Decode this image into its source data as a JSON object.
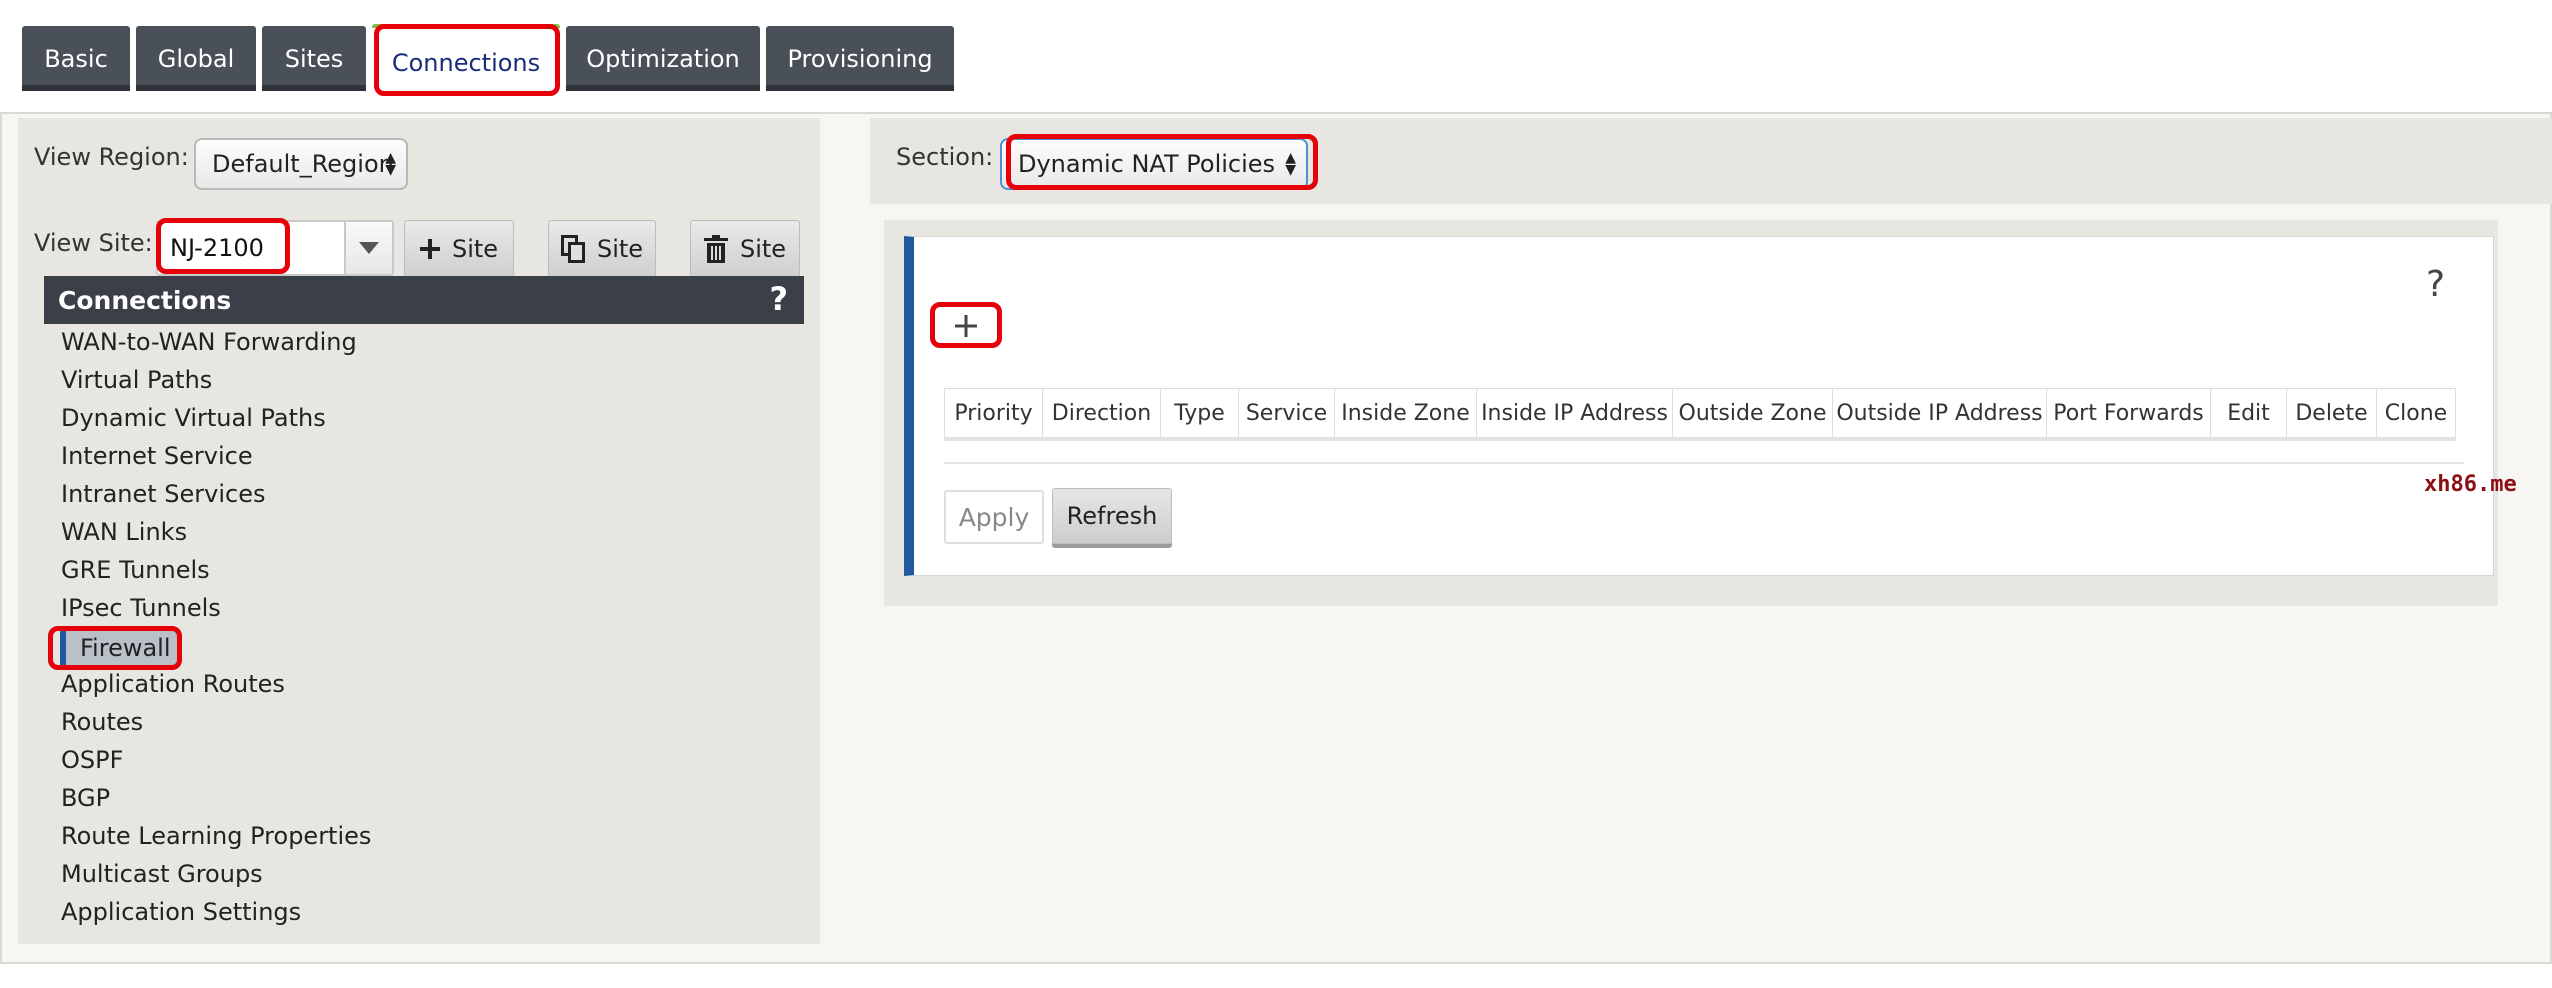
{
  "tabs": [
    {
      "label": "Basic",
      "active": false
    },
    {
      "label": "Global",
      "active": false
    },
    {
      "label": "Sites",
      "active": false
    },
    {
      "label": "Connections",
      "active": true
    },
    {
      "label": "Optimization",
      "active": false
    },
    {
      "label": "Provisioning",
      "active": false
    }
  ],
  "view_region": {
    "label": "View Region:",
    "value": "Default_Region"
  },
  "view_site": {
    "label": "View Site:",
    "value": "NJ-2100",
    "add_button": "Site",
    "copy_button": "Site",
    "delete_button": "Site"
  },
  "menu": {
    "title": "Connections",
    "help": "?",
    "items": [
      "WAN-to-WAN Forwarding",
      "Virtual Paths",
      "Dynamic Virtual Paths",
      "Internet Service",
      "Intranet Services",
      "WAN Links",
      "GRE Tunnels",
      "IPsec Tunnels",
      "Firewall",
      "Application Routes",
      "Routes",
      "OSPF",
      "BGP",
      "Route Learning Properties",
      "Multicast Groups",
      "Application Settings"
    ],
    "selected": "Firewall"
  },
  "section": {
    "label": "Section:",
    "value": "Dynamic NAT Policies"
  },
  "card": {
    "help": "?",
    "add_symbol": "+",
    "columns": [
      "Priority",
      "Direction",
      "Type",
      "Service",
      "Inside Zone",
      "Inside IP Address",
      "Outside Zone",
      "Outside IP Address",
      "Port Forwards",
      "Edit",
      "Delete",
      "Clone"
    ],
    "apply_label": "Apply",
    "refresh_label": "Refresh"
  },
  "watermark": "xh86.me",
  "colors": {
    "tab_bg": "#4a5058",
    "highlight": "#e5000a",
    "accent_bar": "#1f5aa0",
    "menu_header": "#3b4048"
  }
}
